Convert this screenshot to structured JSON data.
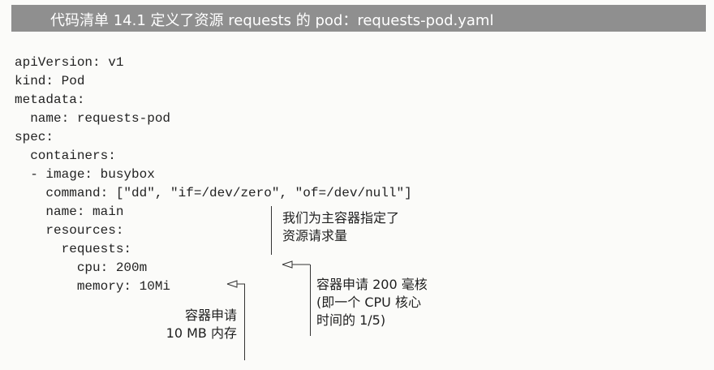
{
  "header": {
    "title": "代码清单 14.1   定义了资源 requests 的 pod：requests-pod.yaml"
  },
  "code": {
    "lines": [
      "apiVersion: v1",
      "kind: Pod",
      "metadata:",
      "  name: requests-pod",
      "spec:",
      "  containers:",
      "  - image: busybox",
      "    command: [\"dd\", \"if=/dev/zero\", \"of=/dev/null\"]",
      "    name: main",
      "    resources:",
      "      requests:",
      "        cpu: 200m",
      "        memory: 10Mi"
    ]
  },
  "annotations": {
    "requests_note": [
      "我们为主容器指定了",
      "资源请求量"
    ],
    "cpu_note": [
      "容器申请 200 毫核",
      "(即一个 CPU 核心",
      "时间的 1/5)"
    ],
    "memory_note": [
      "容器申请",
      "10 MB 内存"
    ]
  }
}
